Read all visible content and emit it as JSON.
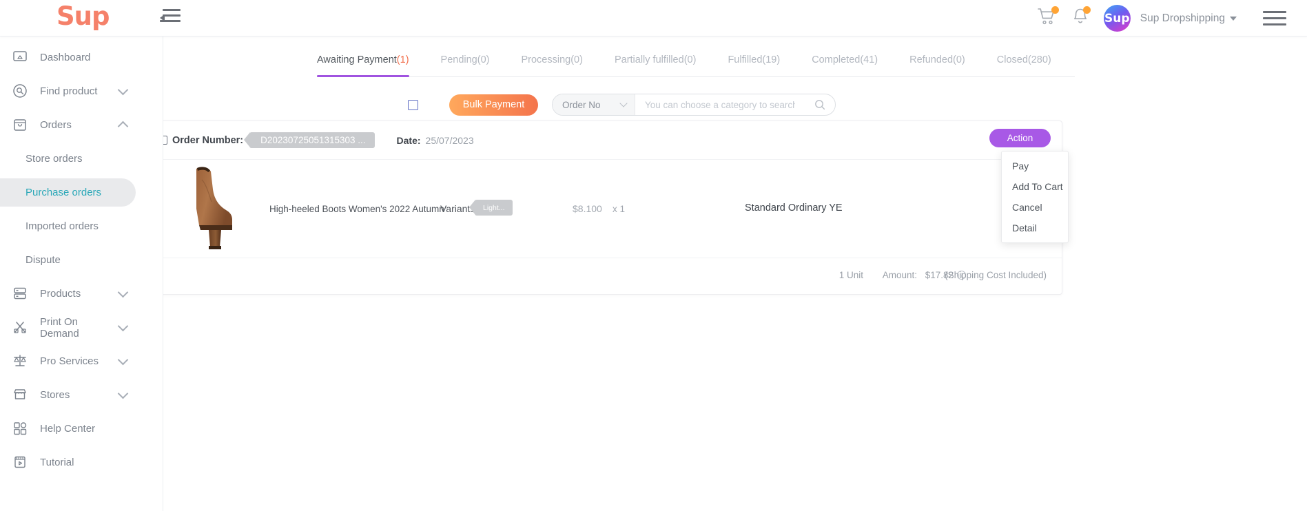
{
  "header": {
    "logo": "Sup",
    "collapse_icon": "collapse-sidebar-icon",
    "cart_icon": "shopping-cart-icon",
    "bell_icon": "notification-bell-icon",
    "avatar_text": "Sup",
    "account_name": "Sup Dropshipping",
    "menu_icon": "hamburger-menu-icon"
  },
  "sidebar": {
    "items": [
      {
        "label": "Dashboard",
        "icon": "dashboard-icon",
        "expandable": false
      },
      {
        "label": "Find product",
        "icon": "search-circle-icon",
        "expandable": true,
        "expanded": false
      },
      {
        "label": "Orders",
        "icon": "bag-icon",
        "expandable": true,
        "expanded": true
      },
      {
        "label": "Products",
        "icon": "products-icon",
        "expandable": true,
        "expanded": false
      },
      {
        "label": "Print On Demand",
        "icon": "print-on-demand-icon",
        "expandable": true,
        "expanded": false
      },
      {
        "label": "Pro Services",
        "icon": "scales-icon",
        "expandable": true,
        "expanded": false
      },
      {
        "label": "Stores",
        "icon": "store-icon",
        "expandable": true,
        "expanded": false
      },
      {
        "label": "Help Center",
        "icon": "help-center-icon",
        "expandable": false
      },
      {
        "label": "Tutorial",
        "icon": "tutorial-icon",
        "expandable": false
      }
    ],
    "orders_children": [
      {
        "label": "Store orders",
        "active": false
      },
      {
        "label": "Purchase orders",
        "active": true
      },
      {
        "label": "Imported orders",
        "active": false
      },
      {
        "label": "Dispute",
        "active": false
      }
    ],
    "active_color": "#2ba8b8"
  },
  "tabs": [
    {
      "label": "Awaiting Payment",
      "count": "(1)",
      "active": true
    },
    {
      "label": "Pending",
      "count": "(0)",
      "active": false
    },
    {
      "label": "Processing",
      "count": "(0)",
      "active": false
    },
    {
      "label": "Partially fulfilled",
      "count": "(0)",
      "active": false
    },
    {
      "label": "Fulfilled",
      "count": "(19)",
      "active": false
    },
    {
      "label": "Completed",
      "count": "(41)",
      "active": false
    },
    {
      "label": "Refunded",
      "count": "(0)",
      "active": false
    },
    {
      "label": "Closed",
      "count": "(280)",
      "active": false
    }
  ],
  "filters": {
    "select_all_checkbox": "",
    "bulk_payment_label": "Bulk Payment",
    "category_select_value": "Order No",
    "search_placeholder": "You can choose a category to search precisely",
    "search_value": "",
    "search_icon": "search-icon"
  },
  "order": {
    "order_number_label": "Order Number:",
    "order_number_value": "D20230725051315303 ...",
    "date_label": "Date:",
    "date_value": "25/07/2023",
    "action_label": "Action",
    "action_menu": [
      "Pay",
      "Add To Cart",
      "Cancel",
      "Detail"
    ],
    "product": {
      "title": "High-heeled Boots Women's 2022 Autumn",
      "variants_label": "Variants:",
      "variant_value": "Light...",
      "price": "$8.100",
      "quantity": "x 1",
      "shipping_method": "Standard Ordinary YE",
      "image_alt": "brown-high-heeled-boot"
    },
    "footer": {
      "unit": "1 Unit",
      "amount_label": "Amount:",
      "amount_value": "$17.82",
      "info_icon": "info-icon",
      "shipping_note": "(Shipping Cost Included)"
    }
  },
  "colors": {
    "brand_orange": "#f5816a",
    "action_purple": "#a859e6",
    "tab_underline": "#a053e0",
    "active_nav": "#2ba8b8",
    "badge": "#ffa435"
  }
}
